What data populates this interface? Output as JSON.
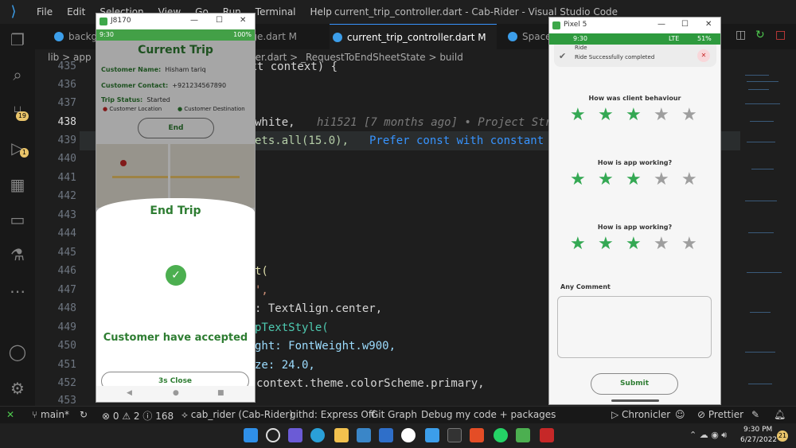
{
  "window": {
    "menu": [
      "File",
      "Edit",
      "Selection",
      "View",
      "Go",
      "Run",
      "Terminal",
      "Help"
    ],
    "title": "current_trip_controller.dart - Cab-Rider - Visual Studio Code"
  },
  "activity": {
    "source_control_badge": "19",
    "debug_badge": "1"
  },
  "tabs": [
    {
      "label": "backg"
    },
    {
      "label": "age.dart M"
    },
    {
      "label": "current_trip_controller.dart M"
    },
    {
      "label": "Spacer"
    }
  ],
  "breadcrumb": {
    "root": "lib",
    "sep": ">",
    "app": "app",
    "tail": "ller.dart > _RequestToEndSheetState > build"
  },
  "lines": [
    "435",
    "436",
    "437",
    "438",
    "439",
    "440",
    "441",
    "442",
    "443",
    "444",
    "445",
    "446",
    "447",
    "448",
    "449",
    "450",
    "451",
    "452",
    "453"
  ],
  "code": {
    "l435": "ext context) {",
    "l438_a": "white,",
    "l438_blame": "hi1521 [7 months ago] • Project Str",
    "l439_a": "ets.all(15.0),",
    "l439_hint": "Prefer const with constant c",
    "l446": "t(",
    "l447": "',",
    "l448": ": TextAlign.center,",
    "l449": "pTextStyle(",
    "l450": "ght: FontWeight.w900,",
    "l451": "ze: 24.0,",
    "l452": "context.theme.colorScheme.primary,"
  },
  "status": {
    "branch": "main*",
    "errors": "0",
    "warnings": "2",
    "info": "168",
    "project": "cab_rider (Cab-Rider)",
    "githd": "githd: Express Off",
    "git_graph": "Git Graph",
    "debug": "Debug my code + packages",
    "chronicler": "Chronicler",
    "prettier": "Prettier"
  },
  "taskbar": {
    "time": "9:30 PM",
    "date": "6/27/2022",
    "notif": "21"
  },
  "emulator1": {
    "title": "J8170",
    "clock": "9:30",
    "battery": "100%",
    "heading": "Current Trip",
    "customer_name_label": "Customer Name:",
    "customer_name": "Hisham tariq",
    "contact_label": "Customer Contact:",
    "contact": "+921234567890",
    "status_label": "Trip Status:",
    "status": "Started",
    "loc_label": "Customer Location",
    "dest_label": "Customer Destination",
    "end_btn": "End",
    "sheet_title": "End Trip",
    "accepted": "Customer have accepted",
    "close_btn": "3s Close"
  },
  "emulator2": {
    "title": "Pixel 5",
    "clock": "9:30",
    "net": "LTE",
    "battery": "51%",
    "toast": "Ride Successfully completed",
    "toast_title": "Ride",
    "questions": [
      {
        "text": "How was client behaviour",
        "rating": 3
      },
      {
        "text": "How is app working?",
        "rating": 3
      },
      {
        "text": "How is app working?",
        "rating": 3
      }
    ],
    "comment_label": "Any Comment",
    "submit": "Submit"
  },
  "colors": {
    "accent": "#3794ff",
    "green": "#2e7d32",
    "star_on": "#34a853",
    "star_off": "#9e9e9e"
  }
}
